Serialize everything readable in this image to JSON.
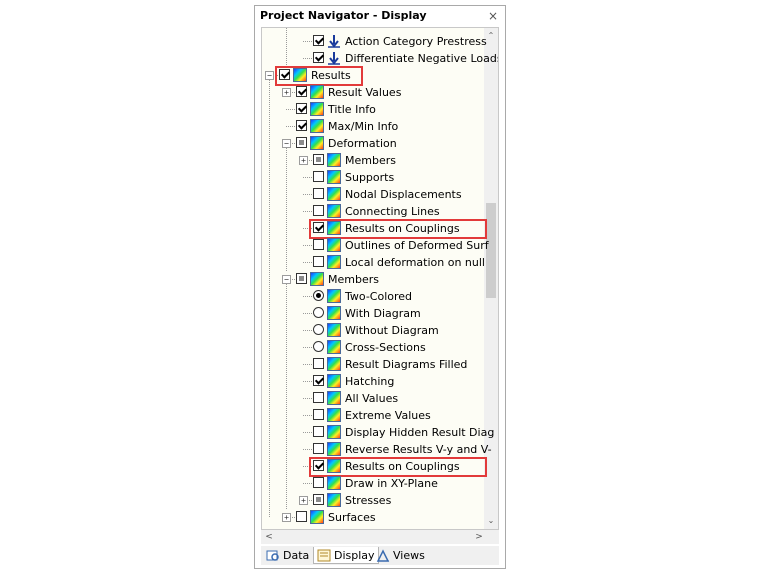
{
  "panel": {
    "title": "Project Navigator - Display",
    "close_glyph": "×"
  },
  "tree": [
    {
      "label": "Action Category Prestress",
      "level": 2,
      "control": "checkbox",
      "state": "checked",
      "icon": "load-arrow-icon",
      "expander": "none"
    },
    {
      "label": "Differentiate Negative Loads",
      "level": 2,
      "control": "checkbox",
      "state": "checked",
      "icon": "load-arrow-icon",
      "expander": "none"
    },
    {
      "label": "Results",
      "level": 0,
      "control": "checkbox",
      "state": "checked",
      "icon": "results-icon",
      "expander": "minus",
      "highlight": true
    },
    {
      "label": "Result Values",
      "level": 1,
      "control": "checkbox",
      "state": "checked",
      "icon": "results-icon",
      "expander": "plus"
    },
    {
      "label": "Title Info",
      "level": 1,
      "control": "checkbox",
      "state": "checked",
      "icon": "results-icon",
      "expander": "none"
    },
    {
      "label": "Max/Min Info",
      "level": 1,
      "control": "checkbox",
      "state": "checked",
      "icon": "results-icon",
      "expander": "none"
    },
    {
      "label": "Deformation",
      "level": 1,
      "control": "checkbox",
      "state": "partial",
      "icon": "results-icon",
      "expander": "minus"
    },
    {
      "label": "Members",
      "level": 2,
      "control": "checkbox",
      "state": "partial",
      "icon": "results-icon",
      "expander": "plus"
    },
    {
      "label": "Supports",
      "level": 2,
      "control": "checkbox",
      "state": "unchecked",
      "icon": "results-icon",
      "expander": "none"
    },
    {
      "label": "Nodal Displacements",
      "level": 2,
      "control": "checkbox",
      "state": "unchecked",
      "icon": "results-icon",
      "expander": "none"
    },
    {
      "label": "Connecting Lines",
      "level": 2,
      "control": "checkbox",
      "state": "unchecked",
      "icon": "results-icon",
      "expander": "none"
    },
    {
      "label": "Results on Couplings",
      "level": 2,
      "control": "checkbox",
      "state": "checked",
      "icon": "results-icon",
      "expander": "none",
      "highlight": true
    },
    {
      "label": "Outlines of Deformed Surf",
      "level": 2,
      "control": "checkbox",
      "state": "unchecked",
      "icon": "results-icon",
      "expander": "none"
    },
    {
      "label": "Local deformation on null",
      "level": 2,
      "control": "checkbox",
      "state": "unchecked",
      "icon": "results-icon",
      "expander": "none"
    },
    {
      "label": "Members",
      "level": 1,
      "control": "checkbox",
      "state": "partial",
      "icon": "results-icon",
      "expander": "minus"
    },
    {
      "label": "Two-Colored",
      "level": 2,
      "control": "radio",
      "state": "on",
      "icon": "results-icon",
      "expander": "none"
    },
    {
      "label": "With Diagram",
      "level": 2,
      "control": "radio",
      "state": "off",
      "icon": "results-icon",
      "expander": "none"
    },
    {
      "label": "Without Diagram",
      "level": 2,
      "control": "radio",
      "state": "off",
      "icon": "results-icon",
      "expander": "none"
    },
    {
      "label": "Cross-Sections",
      "level": 2,
      "control": "radio",
      "state": "off",
      "icon": "results-icon",
      "expander": "none"
    },
    {
      "label": "Result Diagrams Filled",
      "level": 2,
      "control": "checkbox",
      "state": "unchecked",
      "icon": "results-icon",
      "expander": "none"
    },
    {
      "label": "Hatching",
      "level": 2,
      "control": "checkbox",
      "state": "checked",
      "icon": "results-icon",
      "expander": "none"
    },
    {
      "label": "All Values",
      "level": 2,
      "control": "checkbox",
      "state": "unchecked",
      "icon": "results-icon",
      "expander": "none"
    },
    {
      "label": "Extreme Values",
      "level": 2,
      "control": "checkbox",
      "state": "unchecked",
      "icon": "results-icon",
      "expander": "none"
    },
    {
      "label": "Display Hidden Result Diag",
      "level": 2,
      "control": "checkbox",
      "state": "unchecked",
      "icon": "results-icon",
      "expander": "none"
    },
    {
      "label": "Reverse Results V-y and V-",
      "level": 2,
      "control": "checkbox",
      "state": "unchecked",
      "icon": "results-icon",
      "expander": "none"
    },
    {
      "label": "Results on Couplings",
      "level": 2,
      "control": "checkbox",
      "state": "checked",
      "icon": "results-icon",
      "expander": "none",
      "highlight": true
    },
    {
      "label": "Draw in XY-Plane",
      "level": 2,
      "control": "checkbox",
      "state": "unchecked",
      "icon": "results-icon",
      "expander": "none"
    },
    {
      "label": "Stresses",
      "level": 2,
      "control": "checkbox",
      "state": "partial",
      "icon": "results-icon",
      "expander": "plus"
    },
    {
      "label": "Surfaces",
      "level": 1,
      "control": "checkbox",
      "state": "unchecked",
      "icon": "results-icon",
      "expander": "plus"
    }
  ],
  "scrollbar": {
    "up": "⌃",
    "down": "⌄",
    "left": "<",
    "right": ">"
  },
  "tabs": [
    {
      "label": "Data",
      "icon": "data-tab-icon",
      "active": false
    },
    {
      "label": "Display",
      "icon": "display-tab-icon",
      "active": true
    },
    {
      "label": "Views",
      "icon": "views-tab-icon",
      "active": false
    }
  ],
  "colors": {
    "highlight": "#e23a3a",
    "tree_bg": "#fdfdf5"
  }
}
